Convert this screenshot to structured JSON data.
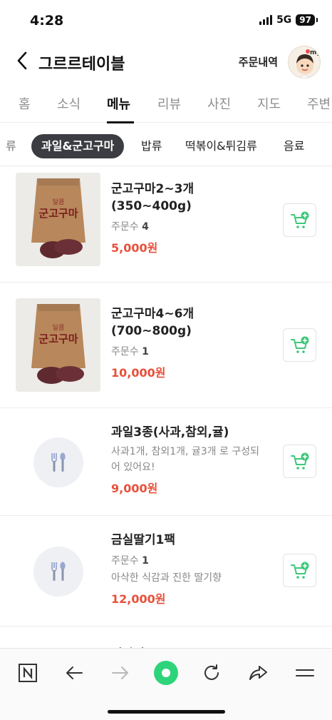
{
  "status_bar": {
    "time": "4:28",
    "network": "5G",
    "battery": "97"
  },
  "header": {
    "title": "그르르테이블",
    "order_history": "주문내역"
  },
  "main_tabs": [
    {
      "label": "홈",
      "active": false
    },
    {
      "label": "소식",
      "active": false
    },
    {
      "label": "메뉴",
      "active": true
    },
    {
      "label": "리뷰",
      "active": false
    },
    {
      "label": "사진",
      "active": false
    },
    {
      "label": "지도",
      "active": false
    },
    {
      "label": "주변",
      "active": false
    }
  ],
  "category_chips": [
    {
      "label": "류",
      "active": false
    },
    {
      "label": "과일&군고구마",
      "active": true
    },
    {
      "label": "밥류",
      "active": false
    },
    {
      "label": "떡볶이&튀김류",
      "active": false
    },
    {
      "label": "음료",
      "active": false
    }
  ],
  "menu_items": [
    {
      "name_line1": "군고구마2~3개",
      "name_line2": "(350~400g)",
      "order_label": "주문수",
      "order_count": "4",
      "price": "5,000원",
      "image": "sweet-potato-bag"
    },
    {
      "name_line1": "군고구마4~6개",
      "name_line2": "(700~800g)",
      "order_label": "주문수",
      "order_count": "1",
      "price": "10,000원",
      "image": "sweet-potato-bag"
    },
    {
      "name_line1": "과일3종(사과,참외,귤)",
      "desc_line1": "사과1개, 참외1개, 귤3개 로 구성되",
      "desc_line2": "어 있어요!",
      "price": "9,000원",
      "image": "utensils-placeholder"
    },
    {
      "name_line1": "금실딸기1팩",
      "order_label": "주문수",
      "order_count": "1",
      "desc_line1": "아삭한 식감과 진한 딸기향",
      "price": "12,000원",
      "image": "utensils-placeholder"
    }
  ],
  "next_item_peek": "귀딸기",
  "thumb_text": {
    "line1": "달콤",
    "line2": "군고구마"
  },
  "colors": {
    "price": "#e8503a",
    "cart_accent": "#3cc87a",
    "chip_active": "#3b3d42"
  },
  "browser_bar": {
    "icons": [
      "naver-n-icon",
      "back-arrow-icon",
      "forward-arrow-icon",
      "green-circle-icon",
      "refresh-icon",
      "share-icon",
      "menu-icon"
    ]
  }
}
